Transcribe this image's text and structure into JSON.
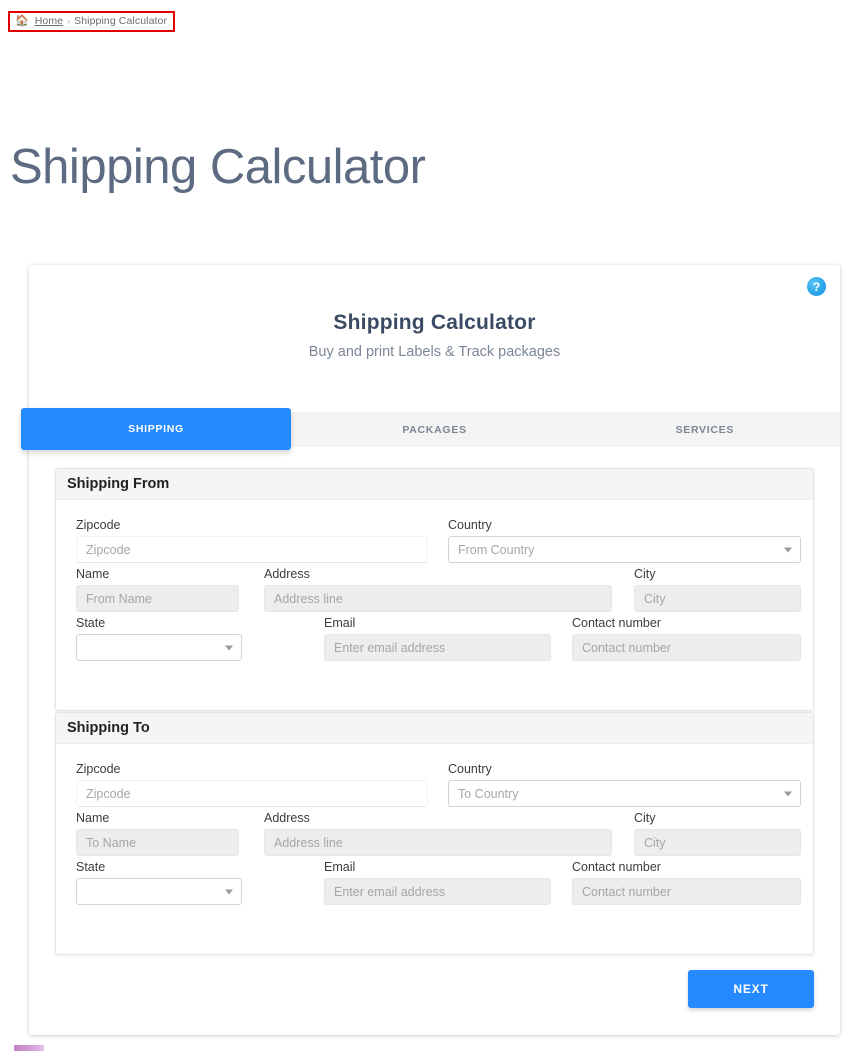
{
  "breadcrumb": {
    "home_icon": "home-icon",
    "home_label": "Home",
    "separator": "›",
    "current": "Shipping Calculator"
  },
  "page": {
    "title": "Shipping Calculator"
  },
  "card": {
    "help_icon_label": "?",
    "title": "Shipping Calculator",
    "subtitle": "Buy and print Labels & Track packages",
    "accent_color": "#2589ff"
  },
  "tabs": [
    {
      "label": "SHIPPING",
      "active": true
    },
    {
      "label": "PACKAGES",
      "active": false
    },
    {
      "label": "SERVICES",
      "active": false
    }
  ],
  "shipping_from": {
    "heading": "Shipping From",
    "zipcode": {
      "label": "Zipcode",
      "value": "",
      "placeholder": "Zipcode"
    },
    "country": {
      "label": "Country",
      "value": "",
      "placeholder": "From Country"
    },
    "name": {
      "label": "Name",
      "value": "",
      "placeholder": "From Name"
    },
    "address": {
      "label": "Address",
      "value": "",
      "placeholder": "Address line"
    },
    "city": {
      "label": "City",
      "value": "",
      "placeholder": "City"
    },
    "state": {
      "label": "State",
      "value": "",
      "placeholder": ""
    },
    "email": {
      "label": "Email",
      "value": "",
      "placeholder": "Enter email address"
    },
    "contact": {
      "label": "Contact number",
      "value": "",
      "placeholder": "Contact number"
    }
  },
  "shipping_to": {
    "heading": "Shipping To",
    "zipcode": {
      "label": "Zipcode",
      "value": "",
      "placeholder": "Zipcode"
    },
    "country": {
      "label": "Country",
      "value": "",
      "placeholder": "To Country"
    },
    "name": {
      "label": "Name",
      "value": "",
      "placeholder": "To Name"
    },
    "address": {
      "label": "Address",
      "value": "",
      "placeholder": "Address line"
    },
    "city": {
      "label": "City",
      "value": "",
      "placeholder": "City"
    },
    "state": {
      "label": "State",
      "value": "",
      "placeholder": ""
    },
    "email": {
      "label": "Email",
      "value": "",
      "placeholder": "Enter email address"
    },
    "contact": {
      "label": "Contact number",
      "value": "",
      "placeholder": "Contact number"
    }
  },
  "footer": {
    "next_label": "NEXT"
  }
}
